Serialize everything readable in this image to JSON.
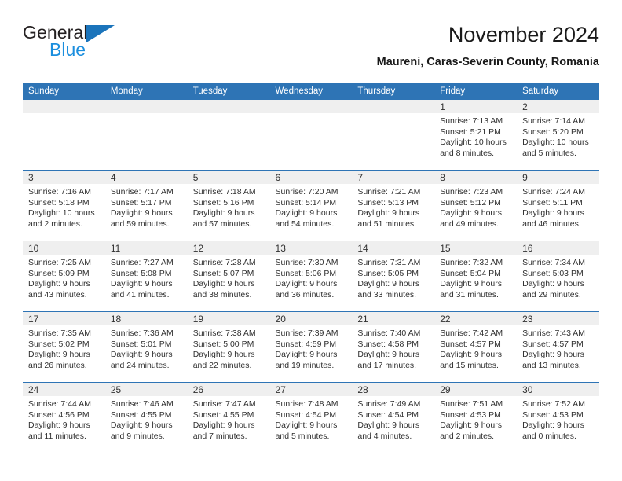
{
  "logo": {
    "word1": "General",
    "word2": "Blue",
    "triangle_color": "#1b74bb",
    "word2_color": "#1b8ede"
  },
  "header": {
    "title": "November 2024",
    "subtitle": "Maureni, Caras-Severin County, Romania"
  },
  "colors": {
    "header_blue": "#2e74b5",
    "daynum_gray": "#efefef",
    "cell_white": "#ffffff",
    "text": "#303030"
  },
  "calendar": {
    "weekday_headers": [
      "Sunday",
      "Monday",
      "Tuesday",
      "Wednesday",
      "Thursday",
      "Friday",
      "Saturday"
    ],
    "weeks": [
      [
        {
          "day": "",
          "empty": true
        },
        {
          "day": "",
          "empty": true
        },
        {
          "day": "",
          "empty": true
        },
        {
          "day": "",
          "empty": true
        },
        {
          "day": "",
          "empty": true
        },
        {
          "day": "1",
          "sunrise": "Sunrise: 7:13 AM",
          "sunset": "Sunset: 5:21 PM",
          "daylight": "Daylight: 10 hours and 8 minutes."
        },
        {
          "day": "2",
          "sunrise": "Sunrise: 7:14 AM",
          "sunset": "Sunset: 5:20 PM",
          "daylight": "Daylight: 10 hours and 5 minutes."
        }
      ],
      [
        {
          "day": "3",
          "sunrise": "Sunrise: 7:16 AM",
          "sunset": "Sunset: 5:18 PM",
          "daylight": "Daylight: 10 hours and 2 minutes."
        },
        {
          "day": "4",
          "sunrise": "Sunrise: 7:17 AM",
          "sunset": "Sunset: 5:17 PM",
          "daylight": "Daylight: 9 hours and 59 minutes."
        },
        {
          "day": "5",
          "sunrise": "Sunrise: 7:18 AM",
          "sunset": "Sunset: 5:16 PM",
          "daylight": "Daylight: 9 hours and 57 minutes."
        },
        {
          "day": "6",
          "sunrise": "Sunrise: 7:20 AM",
          "sunset": "Sunset: 5:14 PM",
          "daylight": "Daylight: 9 hours and 54 minutes."
        },
        {
          "day": "7",
          "sunrise": "Sunrise: 7:21 AM",
          "sunset": "Sunset: 5:13 PM",
          "daylight": "Daylight: 9 hours and 51 minutes."
        },
        {
          "day": "8",
          "sunrise": "Sunrise: 7:23 AM",
          "sunset": "Sunset: 5:12 PM",
          "daylight": "Daylight: 9 hours and 49 minutes."
        },
        {
          "day": "9",
          "sunrise": "Sunrise: 7:24 AM",
          "sunset": "Sunset: 5:11 PM",
          "daylight": "Daylight: 9 hours and 46 minutes."
        }
      ],
      [
        {
          "day": "10",
          "sunrise": "Sunrise: 7:25 AM",
          "sunset": "Sunset: 5:09 PM",
          "daylight": "Daylight: 9 hours and 43 minutes."
        },
        {
          "day": "11",
          "sunrise": "Sunrise: 7:27 AM",
          "sunset": "Sunset: 5:08 PM",
          "daylight": "Daylight: 9 hours and 41 minutes."
        },
        {
          "day": "12",
          "sunrise": "Sunrise: 7:28 AM",
          "sunset": "Sunset: 5:07 PM",
          "daylight": "Daylight: 9 hours and 38 minutes."
        },
        {
          "day": "13",
          "sunrise": "Sunrise: 7:30 AM",
          "sunset": "Sunset: 5:06 PM",
          "daylight": "Daylight: 9 hours and 36 minutes."
        },
        {
          "day": "14",
          "sunrise": "Sunrise: 7:31 AM",
          "sunset": "Sunset: 5:05 PM",
          "daylight": "Daylight: 9 hours and 33 minutes."
        },
        {
          "day": "15",
          "sunrise": "Sunrise: 7:32 AM",
          "sunset": "Sunset: 5:04 PM",
          "daylight": "Daylight: 9 hours and 31 minutes."
        },
        {
          "day": "16",
          "sunrise": "Sunrise: 7:34 AM",
          "sunset": "Sunset: 5:03 PM",
          "daylight": "Daylight: 9 hours and 29 minutes."
        }
      ],
      [
        {
          "day": "17",
          "sunrise": "Sunrise: 7:35 AM",
          "sunset": "Sunset: 5:02 PM",
          "daylight": "Daylight: 9 hours and 26 minutes."
        },
        {
          "day": "18",
          "sunrise": "Sunrise: 7:36 AM",
          "sunset": "Sunset: 5:01 PM",
          "daylight": "Daylight: 9 hours and 24 minutes."
        },
        {
          "day": "19",
          "sunrise": "Sunrise: 7:38 AM",
          "sunset": "Sunset: 5:00 PM",
          "daylight": "Daylight: 9 hours and 22 minutes."
        },
        {
          "day": "20",
          "sunrise": "Sunrise: 7:39 AM",
          "sunset": "Sunset: 4:59 PM",
          "daylight": "Daylight: 9 hours and 19 minutes."
        },
        {
          "day": "21",
          "sunrise": "Sunrise: 7:40 AM",
          "sunset": "Sunset: 4:58 PM",
          "daylight": "Daylight: 9 hours and 17 minutes."
        },
        {
          "day": "22",
          "sunrise": "Sunrise: 7:42 AM",
          "sunset": "Sunset: 4:57 PM",
          "daylight": "Daylight: 9 hours and 15 minutes."
        },
        {
          "day": "23",
          "sunrise": "Sunrise: 7:43 AM",
          "sunset": "Sunset: 4:57 PM",
          "daylight": "Daylight: 9 hours and 13 minutes."
        }
      ],
      [
        {
          "day": "24",
          "sunrise": "Sunrise: 7:44 AM",
          "sunset": "Sunset: 4:56 PM",
          "daylight": "Daylight: 9 hours and 11 minutes."
        },
        {
          "day": "25",
          "sunrise": "Sunrise: 7:46 AM",
          "sunset": "Sunset: 4:55 PM",
          "daylight": "Daylight: 9 hours and 9 minutes."
        },
        {
          "day": "26",
          "sunrise": "Sunrise: 7:47 AM",
          "sunset": "Sunset: 4:55 PM",
          "daylight": "Daylight: 9 hours and 7 minutes."
        },
        {
          "day": "27",
          "sunrise": "Sunrise: 7:48 AM",
          "sunset": "Sunset: 4:54 PM",
          "daylight": "Daylight: 9 hours and 5 minutes."
        },
        {
          "day": "28",
          "sunrise": "Sunrise: 7:49 AM",
          "sunset": "Sunset: 4:54 PM",
          "daylight": "Daylight: 9 hours and 4 minutes."
        },
        {
          "day": "29",
          "sunrise": "Sunrise: 7:51 AM",
          "sunset": "Sunset: 4:53 PM",
          "daylight": "Daylight: 9 hours and 2 minutes."
        },
        {
          "day": "30",
          "sunrise": "Sunrise: 7:52 AM",
          "sunset": "Sunset: 4:53 PM",
          "daylight": "Daylight: 9 hours and 0 minutes."
        }
      ]
    ]
  }
}
